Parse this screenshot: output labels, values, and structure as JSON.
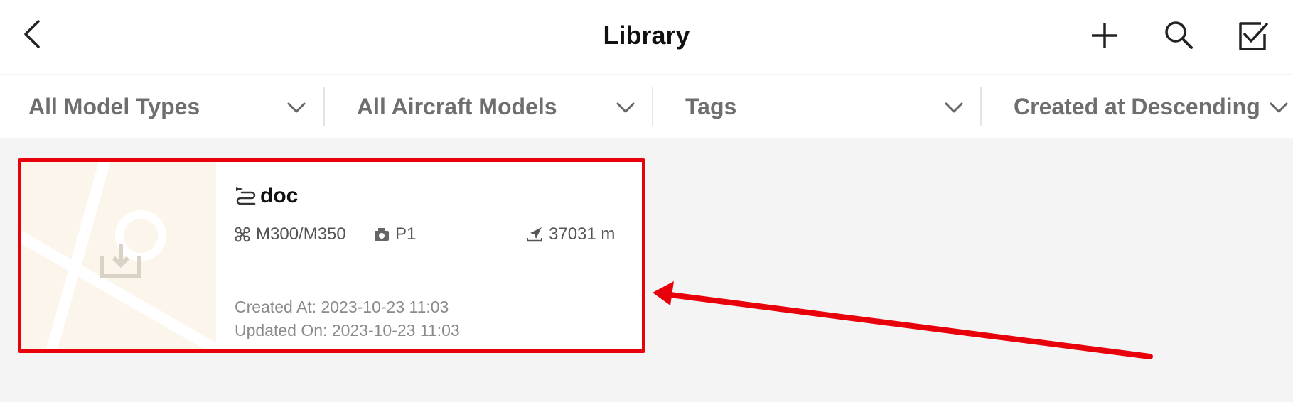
{
  "header": {
    "title": "Library",
    "icons": [
      "back-icon",
      "plus-icon",
      "search-icon",
      "select-checkbox-icon"
    ]
  },
  "filters": [
    {
      "label": "All Model Types"
    },
    {
      "label": "All Aircraft Models"
    },
    {
      "label": "Tags"
    },
    {
      "label": "Created at Descending"
    }
  ],
  "card": {
    "name": "doc",
    "aircraft": "M300/M350",
    "camera": "P1",
    "distance": "37031 m",
    "created": "Created At: 2023-10-23 11:03",
    "updated": "Updated On: 2023-10-23 11:03",
    "icons": [
      "route-icon",
      "drone-icon",
      "camera-icon",
      "distance-icon",
      "download-icon"
    ]
  },
  "annotation": {
    "color": "#e8000b"
  }
}
